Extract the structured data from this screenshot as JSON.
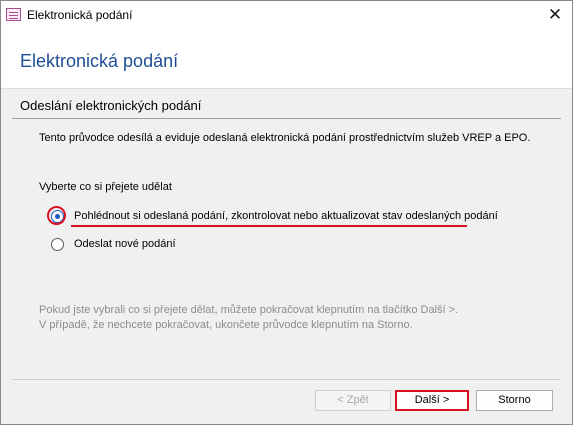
{
  "window": {
    "title": "Elektronická podání",
    "close_glyph": "✕"
  },
  "header": {
    "title": "Elektronická podání"
  },
  "section": {
    "title": "Odeslání elektronických podání"
  },
  "content": {
    "description": "Tento průvodce odesílá a eviduje odeslaná elektronická podání prostřednictvím služeb VREP a EPO.",
    "choose_label": "Vyberte co si přejete udělat",
    "options": [
      {
        "label": "Pohlédnout si odeslaná podání, zkontrolovat nebo aktualizovat stav odeslaných podání",
        "selected": true
      },
      {
        "label": "Odeslat nové podání",
        "selected": false
      }
    ],
    "hint_line1": "Pokud jste vybrali co si přejete dělat, můžete pokračovat klepnutím na tlačítko Další >.",
    "hint_line2": "V případě, že nechcete pokračovat, ukončete průvodce klepnutím na Storno."
  },
  "buttons": {
    "back": "< Zpět",
    "next": "Další >",
    "cancel": "Storno"
  },
  "colors": {
    "header_title": "#1f4e96",
    "highlight": "#d81020",
    "radio_selected": "#1a56c4"
  }
}
